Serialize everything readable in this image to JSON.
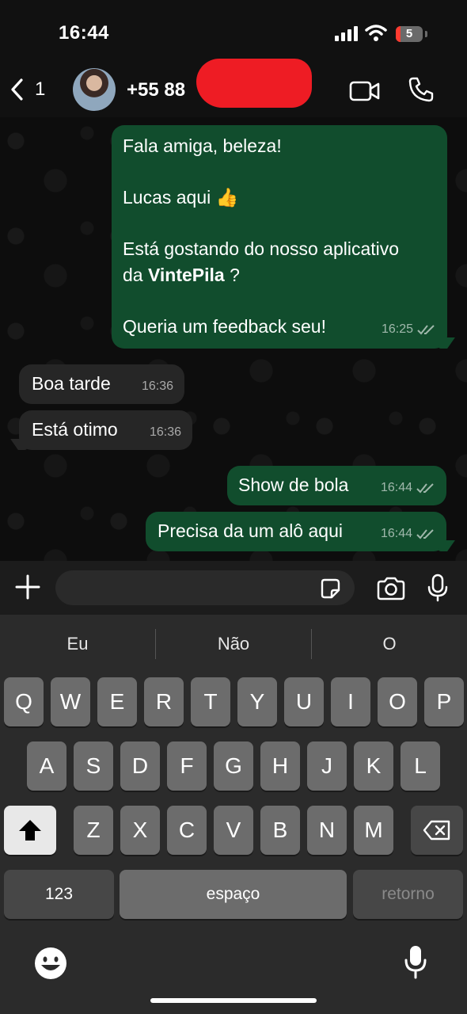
{
  "status": {
    "time": "16:44",
    "battery": "5"
  },
  "header": {
    "back_count": "1",
    "contact_name": "+55 88"
  },
  "messages": [
    {
      "dir": "out",
      "lines": [
        "Fala amiga, beleza!",
        "",
        "Lucas aqui 👍",
        "",
        "Está gostando do nosso aplicativo",
        "da VintePila ?",
        "",
        "Queria um feedback seu!"
      ],
      "time": "16:25"
    },
    {
      "dir": "in",
      "text": "Boa tarde",
      "time": "16:36"
    },
    {
      "dir": "in",
      "text": "Está otimo",
      "time": "16:36"
    },
    {
      "dir": "out",
      "text": "Show de bola",
      "time": "16:44"
    },
    {
      "dir": "out",
      "text": "Precisa da um alô aqui",
      "time": "16:44"
    }
  ],
  "suggestions": [
    "Eu",
    "Não",
    "O"
  ],
  "keyboard": {
    "row1": [
      "Q",
      "W",
      "E",
      "R",
      "T",
      "Y",
      "U",
      "I",
      "O",
      "P"
    ],
    "row2": [
      "A",
      "S",
      "D",
      "F",
      "G",
      "H",
      "J",
      "K",
      "L"
    ],
    "row3": [
      "Z",
      "X",
      "C",
      "V",
      "B",
      "N",
      "M"
    ],
    "num_label": "123",
    "space_label": "espaço",
    "return_label": "retorno"
  },
  "colors": {
    "outgoing_bubble": "#114d2d",
    "incoming_bubble": "#262626",
    "redaction": "#ee1c24"
  }
}
